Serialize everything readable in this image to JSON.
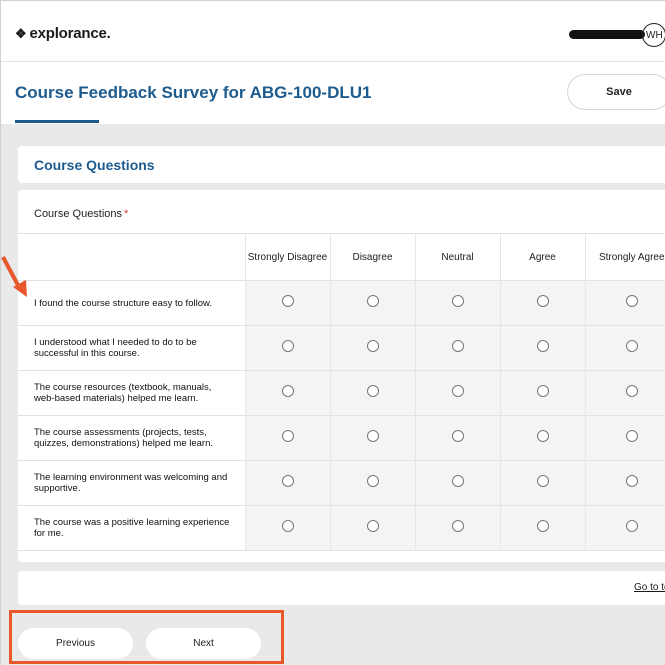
{
  "header": {
    "logo_text": "explorance.",
    "avatar_initials": "WH"
  },
  "title_bar": {
    "title": "Course Feedback Survey for ABG-100-DLU1",
    "save_label": "Save"
  },
  "section": {
    "title": "Course Questions"
  },
  "matrix": {
    "heading": "Course Questions",
    "required_marker": "*",
    "columns": [
      "Strongly Disagree",
      "Disagree",
      "Neutral",
      "Agree",
      "Strongly Agree"
    ],
    "questions": [
      "I found the course structure easy to follow.",
      "I understood what I needed to do to be successful in this course.",
      "The course resources (textbook, manuals, web-based materials) helped me learn.",
      "The course assessments (projects, tests, quizzes, demonstrations) helped me learn.",
      "The learning environment was welcoming and supportive.",
      "The course was a positive learning experience for me."
    ]
  },
  "footer": {
    "go_to_top": "Go to top",
    "previous_label": "Previous",
    "next_label": "Next"
  },
  "colors": {
    "accent": "#1d5b8f",
    "annotation": "#e8582b",
    "background": "#e9e9ec"
  }
}
